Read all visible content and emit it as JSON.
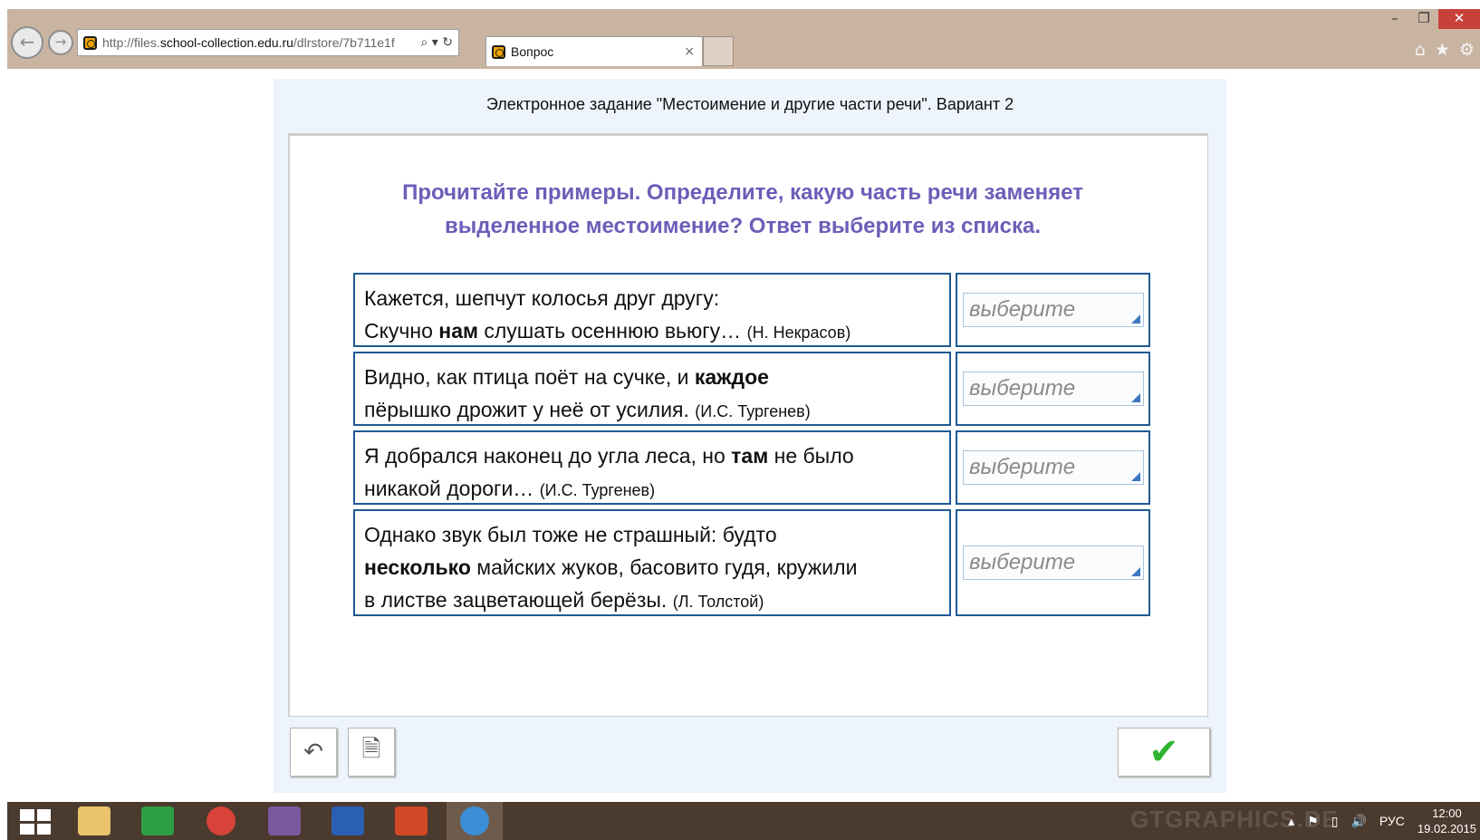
{
  "browser": {
    "url_prefix": "http://files.",
    "url_domain": "school-collection.edu.ru",
    "url_path": "/dlrstore/7b711e1f",
    "tab_title": "Вопрос",
    "tab_close": "×"
  },
  "page": {
    "title": "Электронное задание \"Местоимение и другие части речи\". Вариант 2",
    "instruction_line1": "Прочитайте примеры. Определите, какую часть речи заменяет",
    "instruction_line2": "выделенное местоимение? Ответ выберите из списка.",
    "rows": [
      {
        "line1": "Кажется, шепчут колосья друг другу:",
        "pre": "Скучно ",
        "bold": "нам",
        "post": " слушать осеннюю вьюгу… ",
        "source": "(Н. Некрасов)",
        "select": "выберите"
      },
      {
        "pre": "Видно, как птица поёт на сучке, и ",
        "bold": "каждое",
        "post": "пёрышко дрожит у неё от усилия. ",
        "source": "(И.С. Тургенев)",
        "select": "выберите"
      },
      {
        "pre": "Я добрался наконец до угла леса, но ",
        "bold": "там",
        "post": " не было",
        "line2": "никакой дороги… ",
        "source": "(И.С. Тургенев)",
        "select": "выберите"
      },
      {
        "line1": "Однако звук был тоже не страшный: будто",
        "bold": "несколько",
        "post": " майских жуков, басовито гудя, кружили",
        "line3": "в листве зацветающей берёзы. ",
        "source": "(Л. Толстой)",
        "select": "выберите"
      }
    ]
  },
  "taskbar": {
    "language": "РУС",
    "time": "12:00",
    "date": "19.02.2015",
    "watermark": "GTGRAPHICS.DE"
  }
}
